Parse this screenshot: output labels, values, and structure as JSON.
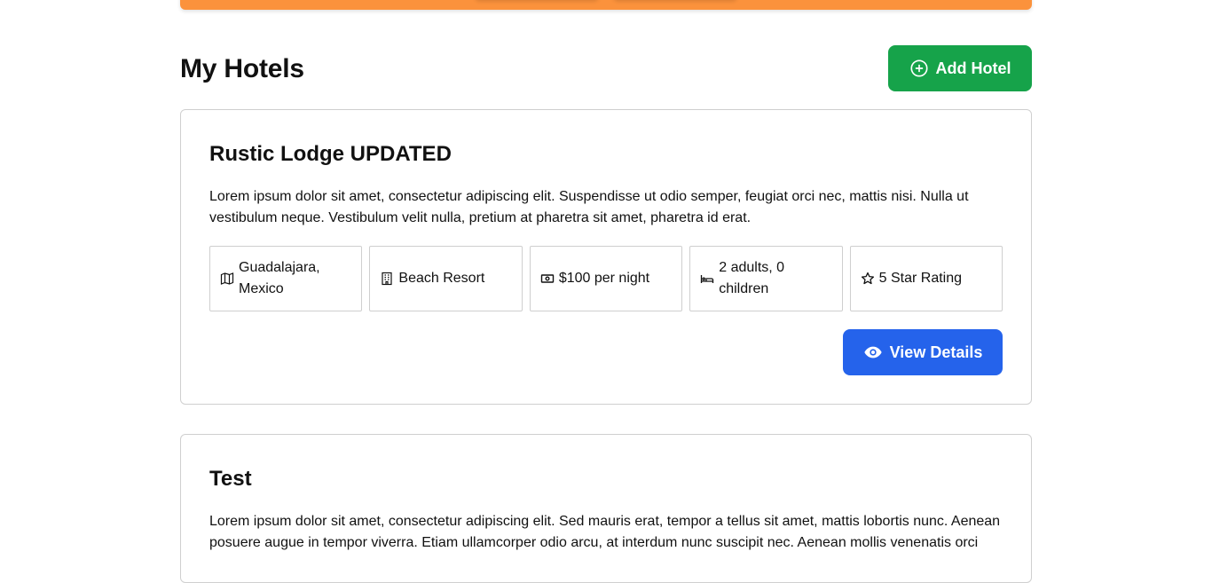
{
  "page": {
    "title": "My Hotels",
    "add_label": "Add Hotel"
  },
  "hotels": [
    {
      "name": "Rustic Lodge UPDATED",
      "description": "Lorem ipsum dolor sit amet, consectetur adipiscing elit. Suspendisse ut odio semper, feugiat orci nec, mattis nisi. Nulla ut vestibulum neque. Vestibulum velit nulla, pretium at pharetra sit amet, pharetra id erat.",
      "location": "Guadalajara, Mexico",
      "type": "Beach Resort",
      "price": "$100 per night",
      "guests": "2 adults, 0 children",
      "rating": "5 Star Rating",
      "view_label": "View Details"
    },
    {
      "name": "Test",
      "description": "Lorem ipsum dolor sit amet, consectetur adipiscing elit. Sed mauris erat, tempor a tellus sit amet, mattis lobortis nunc. Aenean posuere augue in tempor viverra. Etiam ullamcorper odio arcu, at interdum nunc suscipit nec. Aenean mollis venenatis orci"
    }
  ],
  "icons": {
    "add": "plus-circle-icon",
    "location": "map-icon",
    "type": "building-icon",
    "price": "money-icon",
    "guests": "bed-icon",
    "rating": "star-icon",
    "view": "eye-icon"
  },
  "colors": {
    "accent_orange": "#fb923c",
    "add_green": "#16a34a",
    "view_blue": "#2563eb"
  }
}
